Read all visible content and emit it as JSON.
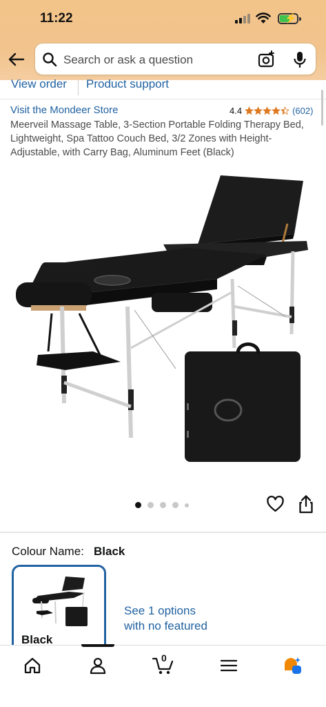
{
  "status_bar": {
    "time": "11:22"
  },
  "search": {
    "placeholder": "Search or ask a question"
  },
  "links": {
    "view_order": "View order",
    "product_support": "Product support"
  },
  "product": {
    "store_link": "Visit the Mondeer Store",
    "rating": "4.4",
    "rating_stars": 4.4,
    "rating_count": "(602)",
    "title": "Meerveil Massage Table, 3-Section Portable Folding Therapy Bed, Lightweight, Spa Tattoo Couch Bed, 3/2 Zones with Height-Adjustable, with Carry Bag, Aluminum Feet (Black)",
    "image_count": 5,
    "active_image_index": 0
  },
  "variation": {
    "label": "Colour Name:",
    "selected_value": "Black",
    "swatch_label": "Black",
    "see_options_text": "See 1 options with no featured"
  },
  "bottom_nav": {
    "items": [
      "home-icon",
      "account-icon",
      "cart-icon",
      "menu-icon",
      "rufus-icon"
    ],
    "cart_count": "0"
  },
  "colors": {
    "header_bg": "#f3c48a",
    "link": "#2162a1",
    "star": "#de7921",
    "accent_orange": "#f08804"
  }
}
